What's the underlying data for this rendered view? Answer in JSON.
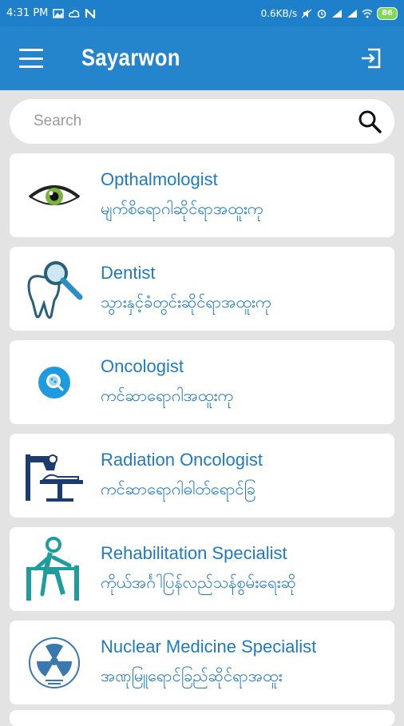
{
  "status_bar": {
    "time": "4:31 PM",
    "network_speed": "0.6KB/s",
    "battery": "86"
  },
  "app_bar": {
    "title": "Sayarwon"
  },
  "search": {
    "placeholder": "Search"
  },
  "specialties": [
    {
      "name": "Opthalmologist",
      "name_mm": "မျက်စိရောဂါဆိုင်ရာအထူးကု",
      "icon": "eye-icon"
    },
    {
      "name": "Dentist",
      "name_mm": "သွားနှင့်ခံတွင်းဆိုင်ရာအထူးကု",
      "icon": "tooth-icon"
    },
    {
      "name": "Oncologist",
      "name_mm": "ကင်ဆာရောဂါအထူးကု",
      "icon": "cell-magnifier-icon"
    },
    {
      "name": "Radiation Oncologist",
      "name_mm": "ကင်ဆာရောဂါဓါတ်ရောင်ခြ",
      "icon": "radiation-machine-icon"
    },
    {
      "name": "Rehabilitation Specialist",
      "name_mm": "ကိုယ်အင်္ဂါပြန်လည်သန်စွမ်းရေးဆို",
      "icon": "rehab-icon"
    },
    {
      "name": "Nuclear Medicine Specialist",
      "name_mm": "အဏုမြူရောင်ခြည်ဆိုင်ရာအထူး",
      "icon": "radiation-symbol-icon"
    }
  ],
  "colors": {
    "app_bar": "#2485cd",
    "status_bar": "#1e7fcb",
    "text_accent": "#1f7ac4",
    "background": "#e3e3e3"
  }
}
